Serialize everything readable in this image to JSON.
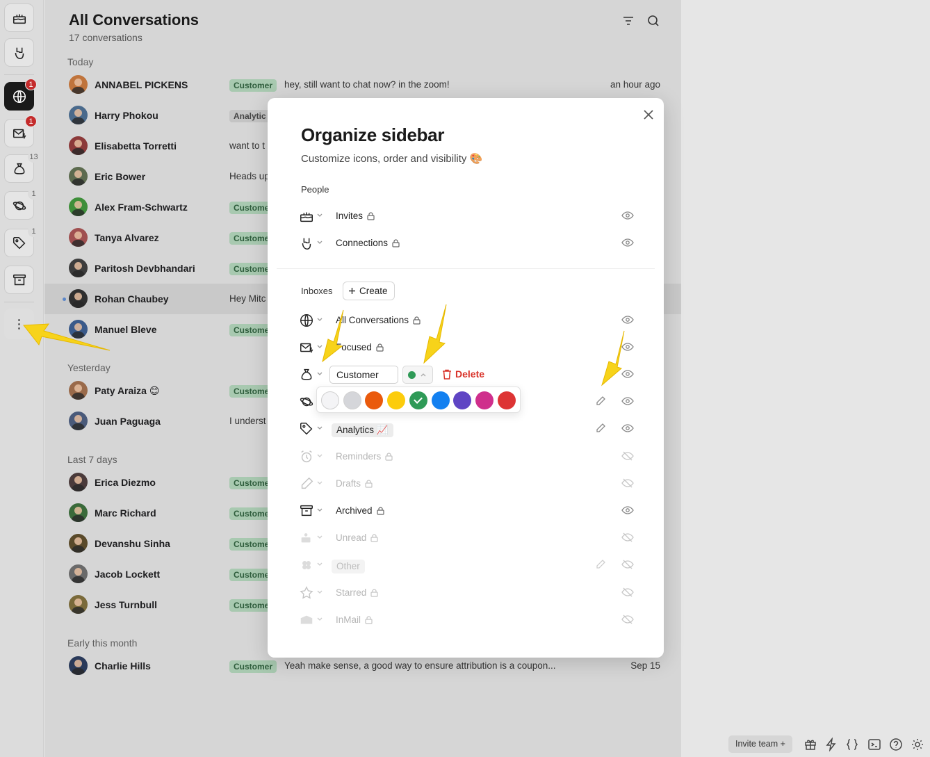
{
  "rail": {
    "badges": {
      "globe": "1",
      "mail": "1",
      "bag": "13",
      "planet": "1",
      "tag": "1"
    }
  },
  "header": {
    "title": "All Conversations",
    "count": "17 conversations"
  },
  "sections": {
    "today": "Today",
    "yesterday": "Yesterday",
    "last7": "Last 7 days",
    "early": "Early this month"
  },
  "conversations": [
    {
      "name": "ANNABEL PICKENS",
      "tag": "Customer",
      "preview": "hey, still want to chat now? in the zoom!",
      "time": "an hour ago"
    },
    {
      "name": "Harry Phokou",
      "tag": "Analytic",
      "preview": "",
      "time": ""
    },
    {
      "name": "Elisabetta Torretti",
      "tag": "",
      "preview": "want to t",
      "time": ""
    },
    {
      "name": "Eric Bower",
      "tag": "",
      "preview": "Heads up",
      "time": ""
    },
    {
      "name": "Alex Fram-Schwartz",
      "tag": "Custome",
      "preview": "",
      "time": ""
    },
    {
      "name": "Tanya Alvarez",
      "tag": "Custome",
      "preview": "",
      "time": ""
    },
    {
      "name": "Paritosh Devbhandari",
      "tag": "Custome",
      "preview": "",
      "time": ""
    },
    {
      "name": "Rohan Chaubey",
      "tag": "",
      "preview": "Hey Mitc",
      "time": ""
    },
    {
      "name": "Manuel Bleve",
      "tag": "Custome",
      "preview": "",
      "time": ""
    },
    {
      "name": "Paty Araiza 😊",
      "tag": "Custome",
      "preview": "",
      "time": ""
    },
    {
      "name": "Juan Paguaga",
      "tag": "",
      "preview": "I underst",
      "time": ""
    },
    {
      "name": "Erica Diezmo",
      "tag": "Custome",
      "preview": "",
      "time": ""
    },
    {
      "name": "Marc Richard",
      "tag": "Custome",
      "preview": "",
      "time": ""
    },
    {
      "name": "Devanshu Sinha",
      "tag": "Custome",
      "preview": "",
      "time": ""
    },
    {
      "name": "Jacob Lockett",
      "tag": "Custome",
      "preview": "",
      "time": ""
    },
    {
      "name": "Jess Turnbull",
      "tag": "Custome",
      "preview": "",
      "time": ""
    },
    {
      "name": "Charlie Hills",
      "tag": "Customer",
      "preview": "Yeah make sense, a good way to ensure attribution is a coupon...",
      "time": "Sep 15"
    }
  ],
  "footer": {
    "invite": "Invite team +"
  },
  "modal": {
    "title": "Organize sidebar",
    "subtitle": "Customize icons, order and visibility 🎨",
    "people_label": "People",
    "inboxes_label": "Inboxes",
    "create_label": "Create",
    "people": [
      {
        "label": "Invites"
      },
      {
        "label": "Connections"
      }
    ],
    "inboxes": {
      "all": "All Conversations",
      "focused": "Focused",
      "edit_value": "Customer",
      "delete_label": "Delete",
      "analytics": "Analytics 📈",
      "reminders": "Reminders",
      "drafts": "Drafts",
      "archived": "Archived",
      "unread": "Unread",
      "other": "Other",
      "starred": "Starred",
      "inmail": "InMail"
    },
    "palette": [
      "#f4f4f6",
      "#d5d6da",
      "#ea5a0c",
      "#fccc0c",
      "#2f9a57",
      "#1380f0",
      "#5f45c4",
      "#cf2f8c",
      "#dd3434"
    ],
    "selected_color": "#2f9a57"
  }
}
